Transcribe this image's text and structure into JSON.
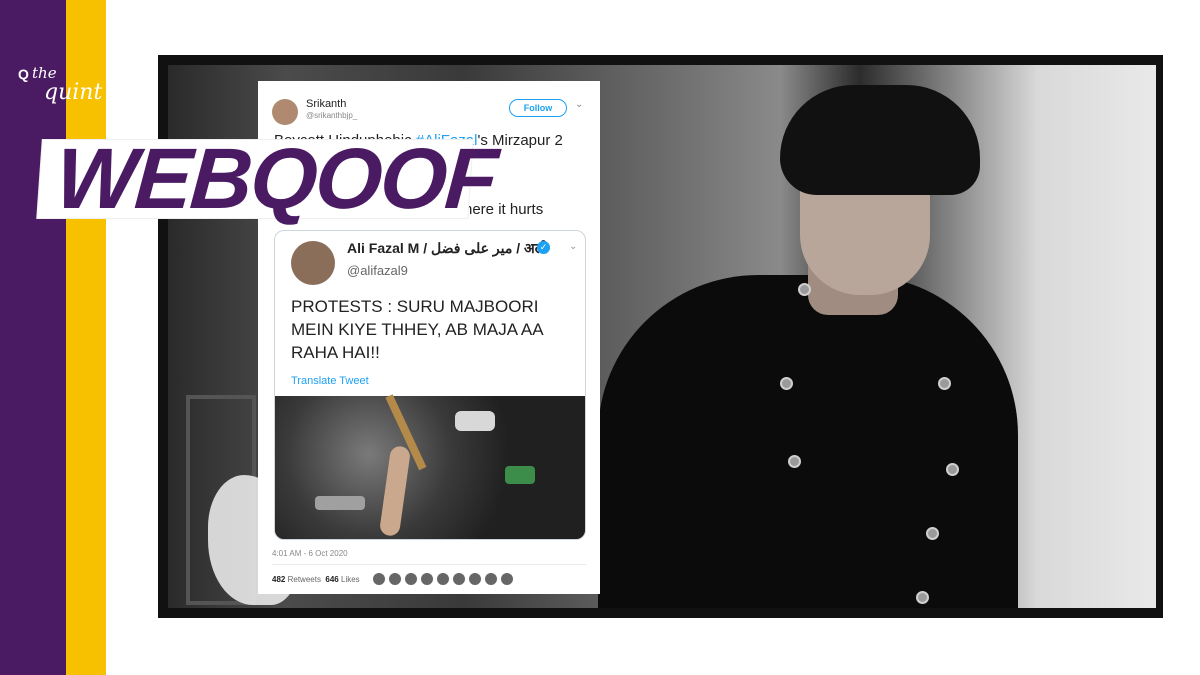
{
  "brand": {
    "logo_the": "the",
    "logo_quint": "quint",
    "logo_mark": "Q"
  },
  "banner": {
    "label": "WEBQOOF"
  },
  "tweet": {
    "author_name": "Srikanth",
    "author_handle": "@srikanthbjp_",
    "follow_label": "Follow",
    "text_line1_prefix": "Boycott Hinduphobic ",
    "text_line1_mention": "#AliFazal",
    "text_line1_suffix": "'s Mirzapur 2",
    "text_line2": "here it hurts",
    "timestamp": "4:01 AM - 6 Oct 2020",
    "retweets_count": "482",
    "retweets_label": "Retweets",
    "likes_count": "646",
    "likes_label": "Likes"
  },
  "quoted_tweet": {
    "author_name": "Ali Fazal M / میر علی فضل / अली",
    "author_handle": "@alifazal9",
    "text": "PROTESTS : SURU MAJBOORI MEIN KIYE THHEY, AB MAJA AA RAHA HAI!!",
    "translate_label": "Translate Tweet"
  },
  "colors": {
    "purple": "#4a1a63",
    "yellow": "#f7c100",
    "twitter_blue": "#1da1f2"
  }
}
